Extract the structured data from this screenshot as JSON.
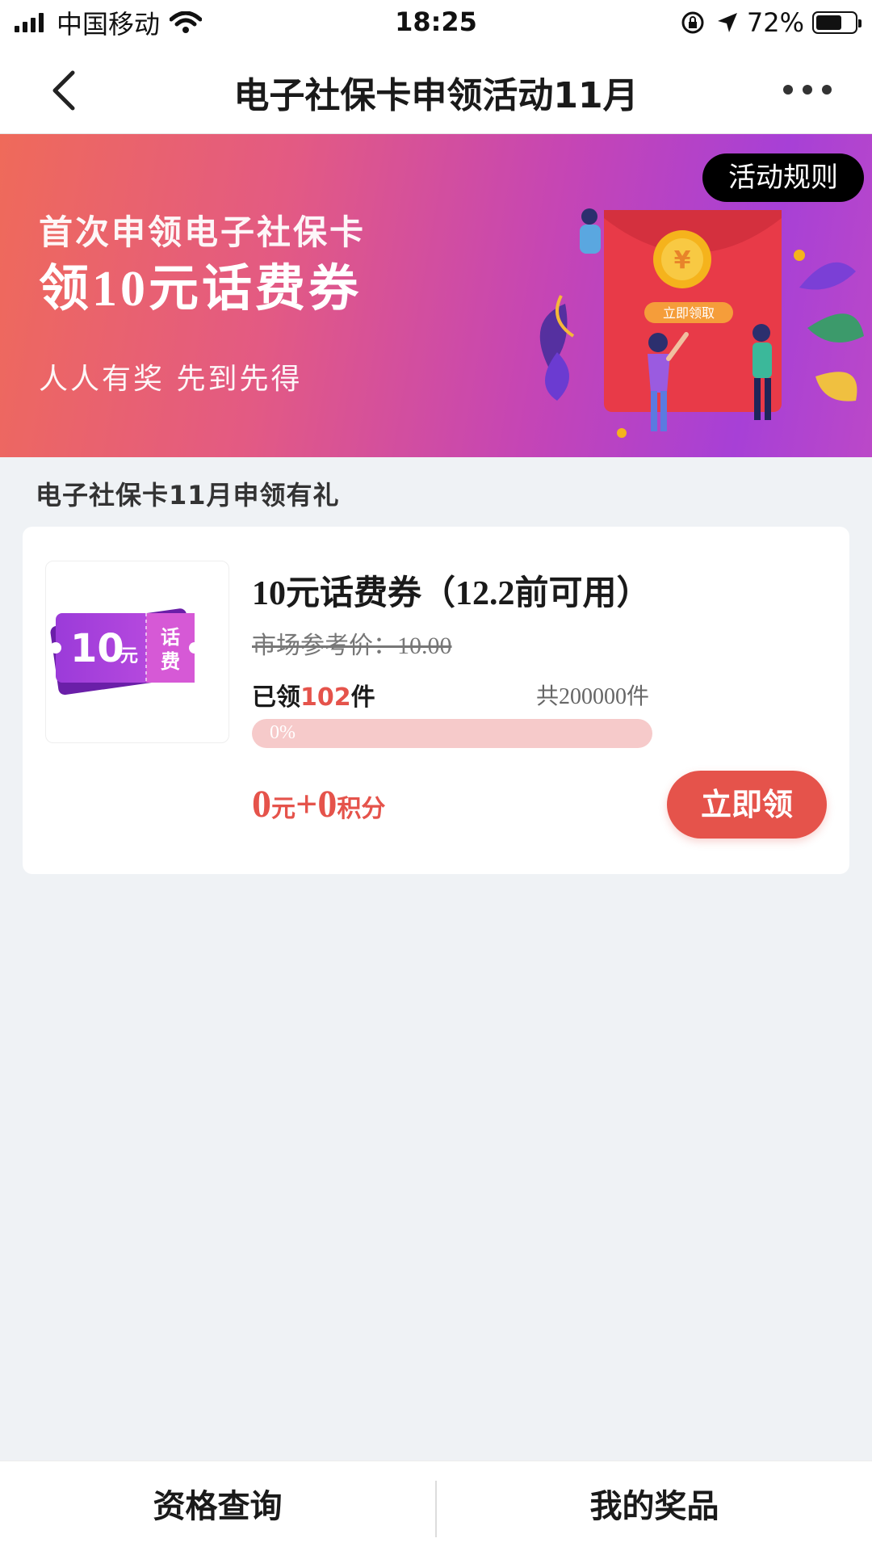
{
  "status_bar": {
    "carrier": "中国移动",
    "time": "18:25",
    "battery_percent": "72%",
    "battery_level": 0.72
  },
  "nav": {
    "title": "电子社保卡申领活动11月"
  },
  "banner": {
    "line1": "首次申领电子社保卡",
    "line2": "领10元话费券",
    "line3": "人人有奖  先到先得",
    "rules_button": "活动规则",
    "illustration_button": "立即领取"
  },
  "section": {
    "title": "电子社保卡11月申领有礼"
  },
  "product": {
    "thumb_amount": "10",
    "thumb_unit": "元",
    "thumb_tag_1": "话",
    "thumb_tag_2": "费",
    "title": "10元话费券（12.2前可用）",
    "market_price": "市场参考价：10.00",
    "claimed_prefix": "已领",
    "claimed_count": "102",
    "claimed_suffix": "件",
    "total": "共200000件",
    "progress_label": "0%",
    "progress_value": 0,
    "price_yuan": "0",
    "price_yuan_unit": "元",
    "price_plus": "+",
    "price_points": "0",
    "price_points_unit": "积分",
    "claim_button": "立即领"
  },
  "tabbar": {
    "left": "资格查询",
    "right": "我的奖品"
  },
  "colors": {
    "accent": "#e5534b",
    "progress_track": "#f6caca",
    "banner_start": "#ef6a5a",
    "banner_end": "#a740d6",
    "background": "#eff2f5"
  }
}
